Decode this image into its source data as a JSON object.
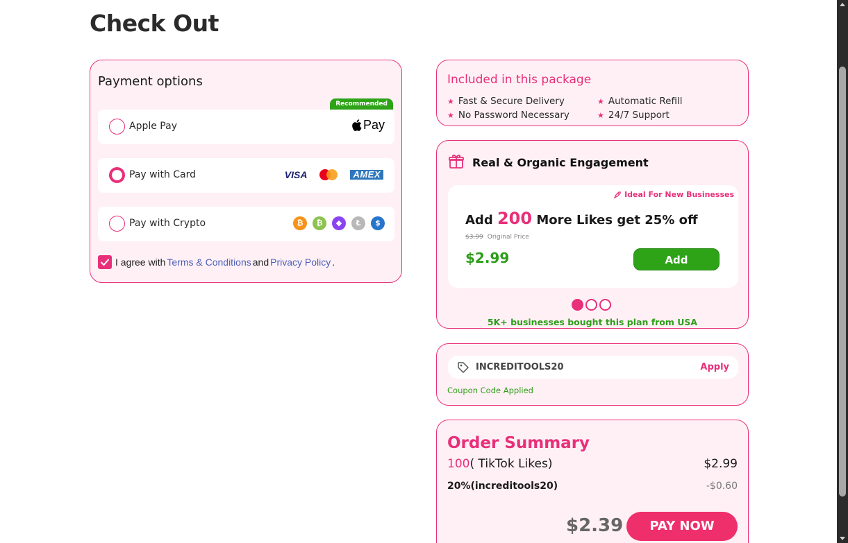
{
  "page": {
    "title": "Check Out"
  },
  "payment": {
    "heading": "Payment options",
    "recommended_badge": "Recommended",
    "options": [
      {
        "label": "Apple Pay",
        "selected": false,
        "logo": "apple-pay-logo",
        "logo_text": "Pay"
      },
      {
        "label": "Pay with Card",
        "selected": true,
        "logos": [
          "VISA",
          "mastercard",
          "AMEX"
        ]
      },
      {
        "label": "Pay with Crypto",
        "selected": false,
        "coins": [
          {
            "name": "bitcoin",
            "symbol": "₿",
            "color": "#f7931a"
          },
          {
            "name": "bitcoin-cash",
            "symbol": "₿",
            "color": "#8dc351"
          },
          {
            "name": "ethereum",
            "symbol": "◆",
            "color": "#8a44f2"
          },
          {
            "name": "litecoin",
            "symbol": "Ł",
            "color": "#b8b8b8"
          },
          {
            "name": "usdc",
            "symbol": "$",
            "color": "#2775ca"
          }
        ]
      }
    ],
    "agree": {
      "checked": true,
      "prefix": "I agree with",
      "terms": "Terms & Conditions",
      "and": "and",
      "privacy": "Privacy Policy",
      "suffix": "."
    }
  },
  "included": {
    "title": "Included in this package",
    "features": [
      "Fast & Secure Delivery",
      "Automatic Refill",
      "No Password Necessary",
      "24/7 Support"
    ]
  },
  "engagement": {
    "title": "Real & Organic Engagement",
    "tag": "Ideal For New Businesses",
    "offer_prefix": "Add",
    "offer_amount": "200",
    "offer_suffix": "More Likes get 25% off",
    "old_price": "$3.99",
    "old_price_label": "Original Price",
    "new_price": "$2.99",
    "add_label": "Add",
    "social_proof": "5K+ businesses bought this plan from USA",
    "slides": 3,
    "active_slide": 0
  },
  "coupon": {
    "code": "INCREDITOOLS20",
    "apply_label": "Apply",
    "status": "Coupon Code Applied"
  },
  "summary": {
    "title": "Order Summary",
    "quantity": "100",
    "item": "( TikTok Likes)",
    "item_price": "$2.99",
    "discount_label": "20%(increditools20)",
    "discount_value": "-$0.60",
    "total": "$2.39",
    "pay_label": "PAY NOW"
  },
  "colors": {
    "accent": "#e8307a",
    "success": "#2ea318",
    "card_bg": "#fff0f5"
  }
}
